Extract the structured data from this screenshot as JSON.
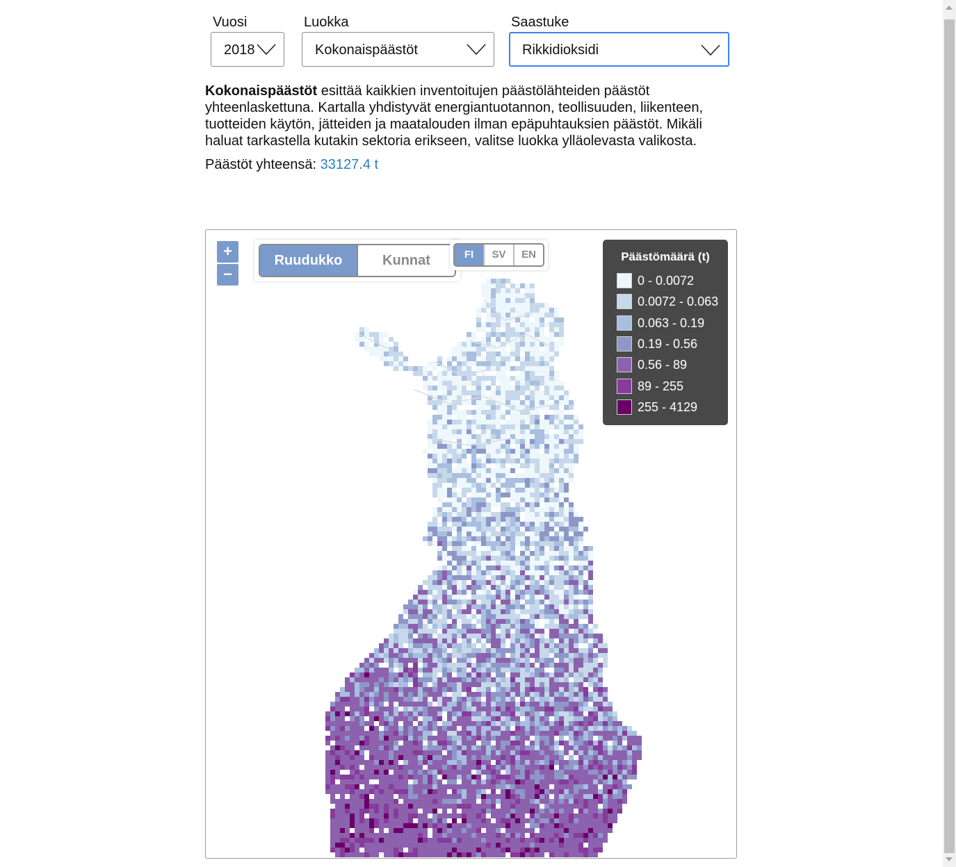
{
  "filters": {
    "year": {
      "label": "Vuosi",
      "value": "2018"
    },
    "category": {
      "label": "Luokka",
      "value": "Kokonaispäästöt"
    },
    "pollutant": {
      "label": "Saastuke",
      "value": "Rikkidioksidi"
    }
  },
  "description": {
    "bold": "Kokonaispäästöt",
    "text": " esittää kaikkien inventoitujen päästölähteiden päästöt yhteenlaskettuna. Kartalla yhdistyvät energiantuotannon, teollisuuden, liikenteen, tuotteiden käytön, jätteiden ja maatalouden ilman epäpuhtauksien päästöt. Mikäli haluat tarkastella kutakin sektoria erikseen, valitse luokka ylläolevasta valikosta."
  },
  "total": {
    "label": "Päästöt yhteensä:",
    "value": "33127.4 t"
  },
  "map": {
    "zoom_in": "+",
    "zoom_out": "−",
    "view_toggle": {
      "active": "Ruudukko",
      "inactive": "Kunnat"
    },
    "languages": [
      {
        "code": "FI",
        "active": true
      },
      {
        "code": "SV",
        "active": false
      },
      {
        "code": "EN",
        "active": false
      }
    ],
    "legend": {
      "title": "Päästömäärä (t)",
      "classes": [
        {
          "label": "0 - 0.0072",
          "color": "#eef7fb"
        },
        {
          "label": "0.0072 - 0.063",
          "color": "#c7d8ea"
        },
        {
          "label": "0.063 - 0.19",
          "color": "#a8bfdf"
        },
        {
          "label": "0.19 - 0.56",
          "color": "#8e97c8"
        },
        {
          "label": "0.56 - 89",
          "color": "#8c62ae"
        },
        {
          "label": "89 - 255",
          "color": "#873b9b"
        },
        {
          "label": "255 - 4129",
          "color": "#6a0066"
        }
      ]
    }
  },
  "colors": {
    "accent": "#7a9acb",
    "link": "#2a7fc1",
    "focus": "#3b82f6"
  }
}
